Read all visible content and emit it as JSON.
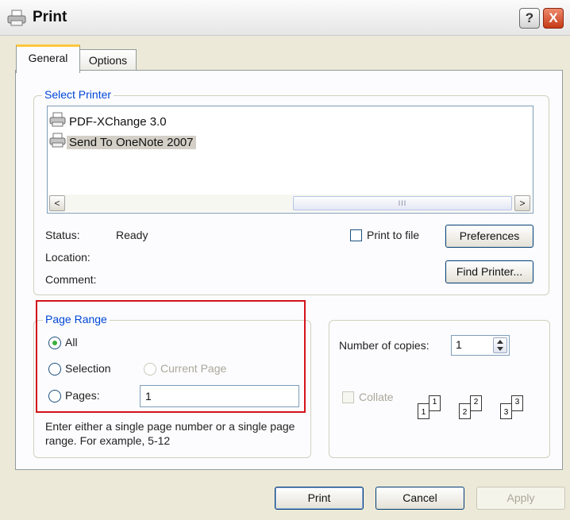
{
  "window": {
    "title": "Print",
    "help_label": "?",
    "close_label": "X"
  },
  "tabs": [
    {
      "label": "General",
      "selected": true
    },
    {
      "label": "Options",
      "selected": false
    }
  ],
  "select_printer": {
    "legend": "Select Printer",
    "printers": [
      {
        "name": "PDF-XChange 3.0",
        "selected": false
      },
      {
        "name": "Send To OneNote 2007",
        "selected": true
      }
    ],
    "scroll_left": "<",
    "scroll_right": ">",
    "scroll_grip": "III",
    "status_label": "Status:",
    "status_value": "Ready",
    "location_label": "Location:",
    "location_value": "",
    "comment_label": "Comment:",
    "comment_value": "",
    "print_to_file_label": "Print to file",
    "print_to_file_checked": false,
    "preferences_label": "Preferences",
    "find_printer_label": "Find Printer..."
  },
  "page_range": {
    "legend": "Page Range",
    "options": {
      "all": "All",
      "selection": "Selection",
      "current_page": "Current Page",
      "pages": "Pages:"
    },
    "selected": "all",
    "pages_value": "1",
    "hint": "Enter either a single page number or a single page range.  For example, 5-12"
  },
  "copies": {
    "number_label": "Number of copies:",
    "number_value": "1",
    "collate_label": "Collate",
    "collate_checked": false,
    "collate_pages": [
      "1",
      "1",
      "2",
      "2",
      "3",
      "3"
    ]
  },
  "footer": {
    "print_label": "Print",
    "cancel_label": "Cancel",
    "apply_label": "Apply"
  },
  "colors": {
    "group_title": "#0046d5",
    "highlight": "#d3141a",
    "dialog_face": "#ece9d8"
  }
}
